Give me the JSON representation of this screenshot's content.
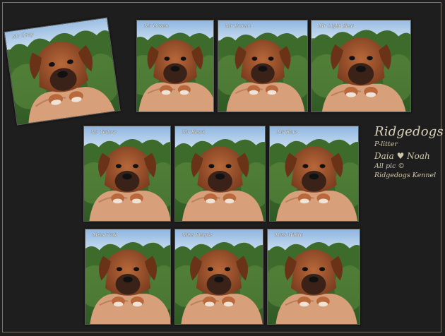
{
  "photos": [
    {
      "caption": "Mr Grey"
    },
    {
      "caption": "Mr Green"
    },
    {
      "caption": "Mr Brown"
    },
    {
      "caption": "Mr Light Blue"
    },
    {
      "caption": "Mr Yellow"
    },
    {
      "caption": "Mr Black"
    },
    {
      "caption": "Mr Blue"
    },
    {
      "caption": "Miss Pink"
    },
    {
      "caption": "Miss Purple"
    },
    {
      "caption": "Miss White"
    }
  ],
  "info": {
    "title": "Ridgedogs",
    "litter": "P-litter",
    "parents": "Daia ♥ Noah",
    "copyright": "All pic ©",
    "kennel": "Ridgedogs Kennel"
  },
  "colors": {
    "background": "#1e1e1e",
    "frame": "#7c7469",
    "text": "#d9d0b6",
    "sky": "#a9c6e4",
    "forest": "#3a6a2a",
    "puppy": "#a0522d",
    "hand": "#d9a27c"
  }
}
